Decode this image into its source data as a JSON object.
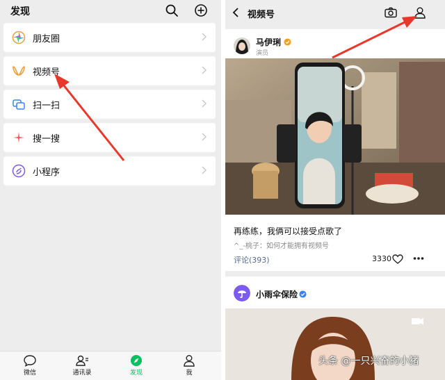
{
  "left": {
    "title": "发现",
    "menu": [
      {
        "label": "朋友圈",
        "icon": "moments-icon"
      },
      {
        "label": "视频号",
        "icon": "channels-icon"
      },
      {
        "label": "扫一扫",
        "icon": "scan-icon"
      },
      {
        "label": "搜一搜",
        "icon": "search-star-icon"
      },
      {
        "label": "小程序",
        "icon": "mini-program-icon"
      }
    ],
    "tabs": [
      {
        "label": "微信",
        "active": false
      },
      {
        "label": "通讯录",
        "active": false
      },
      {
        "label": "发现",
        "active": true
      },
      {
        "label": "我",
        "active": false
      }
    ]
  },
  "right": {
    "title": "视频号",
    "post1": {
      "author": "马伊琍",
      "author_sub": "演员",
      "caption": "再练练，我俩可以接受点歌了",
      "sub_caption": "^_-桃子：如何才能拥有视频号",
      "comments": "评论(393)",
      "likes": "3330"
    },
    "post2": {
      "author": "小雨伞保险"
    }
  },
  "watermark": "头条 @一只兴奋的小猪",
  "colors": {
    "accent": "#07c160",
    "link": "#576b95",
    "verified_gold": "#f0a31a",
    "verified_blue": "#3b82f6",
    "annotation_arrow": "#e8372b"
  }
}
